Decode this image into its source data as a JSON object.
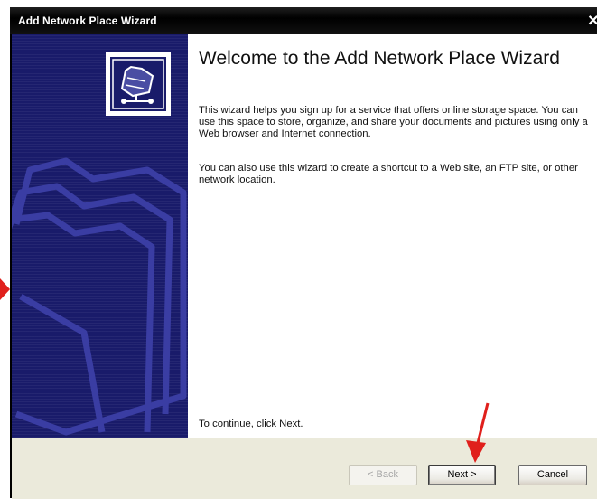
{
  "window": {
    "title": "Add Network Place Wizard",
    "close_glyph": "×"
  },
  "content": {
    "heading": "Welcome to the Add Network Place Wizard",
    "paragraph1": "This wizard helps you sign up for a service that offers online storage space. You can use this space to store, organize, and share your documents and pictures using only a Web browser and Internet connection.",
    "paragraph2": "You can also use this wizard to create a shortcut to a Web site, an FTP site, or other network location.",
    "continue_text": "To continue, click Next."
  },
  "buttons": {
    "back": "< Back",
    "next": "Next >",
    "cancel": "Cancel"
  },
  "icons": {
    "wizard": "network-folder-icon",
    "annotation": "red-arrow-icon"
  },
  "colors": {
    "side_panel": "#191b6a",
    "annotation": "#e0201c",
    "footer": "#ebeadb"
  }
}
